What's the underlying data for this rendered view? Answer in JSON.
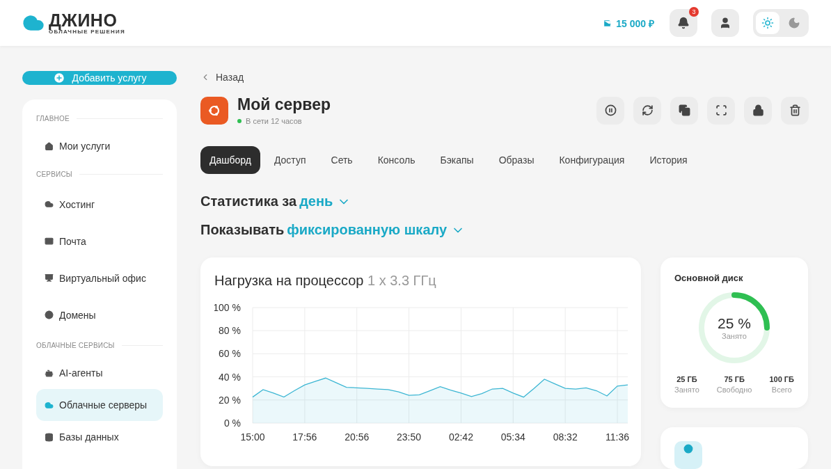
{
  "header": {
    "logo": {
      "name": "ДЖИНО",
      "tagline": "ОБЛАЧНЫЕ РЕШЕНИЯ"
    },
    "balance": "15 000 ₽",
    "notifications": {
      "count": "3"
    },
    "theme": [
      {
        "kind": "light",
        "selected": true
      },
      {
        "kind": "dark",
        "selected": false
      }
    ]
  },
  "sidebar": {
    "add_button": "Добавить услугу",
    "groups": [
      {
        "title": "ГЛАВНОЕ",
        "items": [
          {
            "label": "Мои услуги",
            "selected": false
          }
        ]
      },
      {
        "title": "СЕРВИСЫ",
        "items": [
          {
            "label": "Хостинг",
            "selected": false
          },
          {
            "label": "Почта",
            "selected": false
          },
          {
            "label": "Виртуальный офис",
            "selected": false
          },
          {
            "label": "Домены",
            "selected": false
          }
        ]
      },
      {
        "title": "ОБЛАЧНЫЕ СЕРВИСЫ",
        "items": [
          {
            "label": "AI-агенты",
            "selected": false
          },
          {
            "label": "Облачные серверы",
            "selected": true
          },
          {
            "label": "Базы данных",
            "selected": false
          }
        ]
      }
    ]
  },
  "back": "Назад",
  "server": {
    "name": "Мой сервер",
    "online": true,
    "status": "В сети 12 часов",
    "actions": [
      {
        "kind": "pause"
      },
      {
        "kind": "restart"
      },
      {
        "kind": "copy"
      },
      {
        "kind": "screen"
      },
      {
        "kind": "lock"
      },
      {
        "kind": "delete"
      }
    ]
  },
  "tabs": [
    {
      "label": "Дашборд",
      "selected": true
    },
    {
      "label": "Доступ",
      "selected": false
    },
    {
      "label": "Сеть",
      "selected": false
    },
    {
      "label": "Консоль",
      "selected": false
    },
    {
      "label": "Бэкапы",
      "selected": false
    },
    {
      "label": "Образы",
      "selected": false
    },
    {
      "label": "Конфигурация",
      "selected": false
    },
    {
      "label": "История",
      "selected": false
    }
  ],
  "filters": [
    {
      "label": "Статистика за",
      "value": "день"
    },
    {
      "label": "Показывать",
      "value": "фиксированную шкалу"
    }
  ],
  "cpu": {
    "title": "Нагрузка на процессор",
    "spec": "1 x 3.3 ГГц",
    "chart_data": {
      "type": "area",
      "categories": [
        "15:00",
        null,
        null,
        null,
        null,
        "17:56",
        null,
        null,
        null,
        null,
        "20:56",
        null,
        null,
        null,
        null,
        "23:50",
        null,
        null,
        null,
        null,
        "02:42",
        null,
        null,
        null,
        null,
        "05:34",
        null,
        null,
        null,
        null,
        "08:32",
        null,
        null,
        null,
        null,
        "11:36",
        null
      ],
      "series": [
        {
          "color": "#3cb6d3",
          "values": [
            22.5,
            29,
            26,
            22.5,
            28,
            33,
            36,
            39,
            35,
            31,
            30.5,
            30,
            29.5,
            29,
            27,
            24,
            24.5,
            28,
            31.5,
            28.5,
            26,
            23,
            25.5,
            29.5,
            30,
            26,
            22.5,
            30,
            38,
            34,
            30,
            29.5,
            30.5,
            28,
            23.5,
            32,
            33
          ]
        }
      ],
      "ylim": [
        0,
        100
      ],
      "grid": true,
      "yticks": [
        {
          "value": 0,
          "label": "0 %"
        },
        {
          "value": 20,
          "label": "20 %"
        },
        {
          "value": 40,
          "label": "40 %"
        },
        {
          "value": 60,
          "label": "60 %"
        },
        {
          "value": 80,
          "label": "80 %"
        },
        {
          "value": 100,
          "label": "100 %"
        }
      ]
    }
  },
  "disk": {
    "title": "Основной диск",
    "level": 0.25,
    "percent": "25 %",
    "percent_caption": "Занято",
    "stats": [
      {
        "value": "25 ГБ",
        "caption": "Занято"
      },
      {
        "value": "75 ГБ",
        "caption": "Свободно"
      },
      {
        "value": "100 ГБ",
        "caption": "Всего"
      }
    ]
  }
}
